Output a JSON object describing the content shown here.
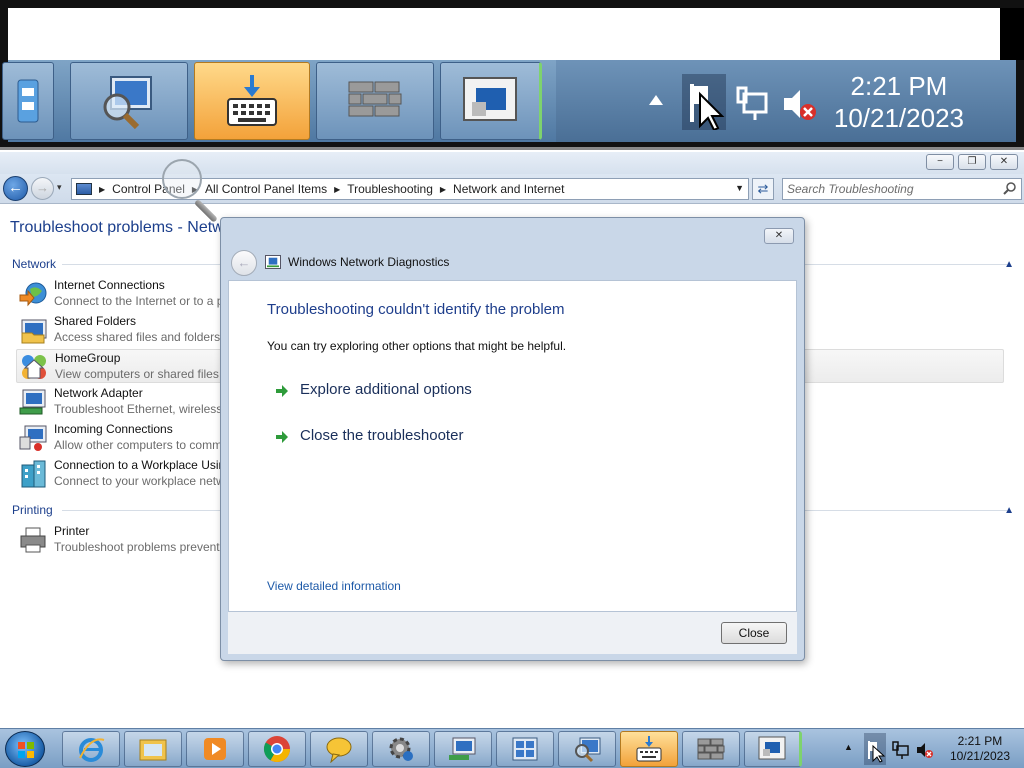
{
  "magnifier": {
    "clock_time": "2:21 PM",
    "clock_date": "10/21/2023"
  },
  "window": {
    "caption_minimize": "−",
    "caption_maximize": "❐",
    "caption_close": "✕"
  },
  "nav": {
    "back_glyph": "←",
    "forward_glyph": "→",
    "history_glyph": "▾",
    "breadcrumbs": [
      "Control Panel",
      "All Control Panel Items",
      "Troubleshooting",
      "Network and Internet"
    ],
    "breadcrumb_separator": "▶",
    "dropdown_glyph": "▼",
    "refresh_glyph": "⇄",
    "search_placeholder": "Search Troubleshooting"
  },
  "page": {
    "title": "Troubleshoot problems - Netw",
    "sections": [
      {
        "heading": "Network",
        "items": [
          {
            "title": "Internet Connections",
            "desc": "Connect to the Internet or to a p"
          },
          {
            "title": "Shared Folders",
            "desc": "Access shared files and folders o"
          },
          {
            "title": "HomeGroup",
            "desc": "View computers or shared files i"
          },
          {
            "title": "Network Adapter",
            "desc": "Troubleshoot Ethernet, wireless,"
          },
          {
            "title": "Incoming Connections",
            "desc": "Allow other computers to comm"
          },
          {
            "title": "Connection to a Workplace Usin",
            "desc": "Connect to your workplace netw"
          }
        ]
      },
      {
        "heading": "Printing",
        "items": [
          {
            "title": "Printer",
            "desc": "Troubleshoot problems prevent"
          }
        ]
      }
    ],
    "collapse_glyph": "▲"
  },
  "dialog": {
    "title": "Windows Network Diagnostics",
    "close_glyph": "✕",
    "back_glyph": "←",
    "heading": "Troubleshooting couldn't identify the problem",
    "subtext": "You can try exploring other options that might be helpful.",
    "options": [
      "Explore additional options",
      "Close the troubleshooter"
    ],
    "detail_link": "View detailed information",
    "close_button": "Close"
  },
  "taskbar": {
    "clock_time": "2:21 PM",
    "clock_date": "10/21/2023",
    "tray_arrow": "▲"
  },
  "colors": {
    "link_blue": "#1e5aa8",
    "heading_blue": "#1e3e8c",
    "green_arrow": "#2e9b3a"
  }
}
